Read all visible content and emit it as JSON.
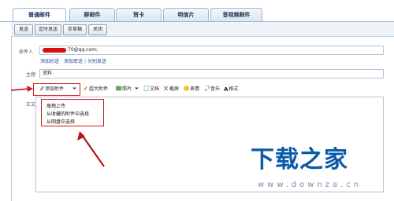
{
  "tabs": [
    {
      "label": "普通邮件",
      "active": true
    },
    {
      "label": "群邮件",
      "active": false
    },
    {
      "label": "贺卡",
      "active": false
    },
    {
      "label": "明信片",
      "active": false
    },
    {
      "label": "音视频邮件",
      "active": false
    }
  ],
  "toolbar": {
    "send": "发送",
    "scheduled_send": "定时发送",
    "save_draft": "存草稿",
    "close": "关闭"
  },
  "recipient": {
    "label": "收件人",
    "value_suffix": "70@qq.com;"
  },
  "recipient_links": {
    "add_cc": "添加抄送",
    "add_bcc": "添加密送",
    "separate_send": "分别发送",
    "separator": "|"
  },
  "subject": {
    "label": "主题",
    "value": "资料"
  },
  "editor_toolbar": {
    "add_attachment": "添加附件",
    "large_attachment": "超大附件",
    "photo": "照片",
    "document": "文档",
    "screenshot": "截屏",
    "emoji": "表情",
    "music": "音乐",
    "format": "格式"
  },
  "body_label": "正文",
  "attachment_menu": {
    "items": [
      "瓶拽上传",
      "从收藏的附件中选择",
      "从网盘中选择"
    ]
  },
  "watermark": {
    "title": "下载之家",
    "url": "www.downza.cn"
  },
  "colors": {
    "highlight": "#d02020",
    "link": "#22489a",
    "watermark": "#0a5aa8"
  }
}
